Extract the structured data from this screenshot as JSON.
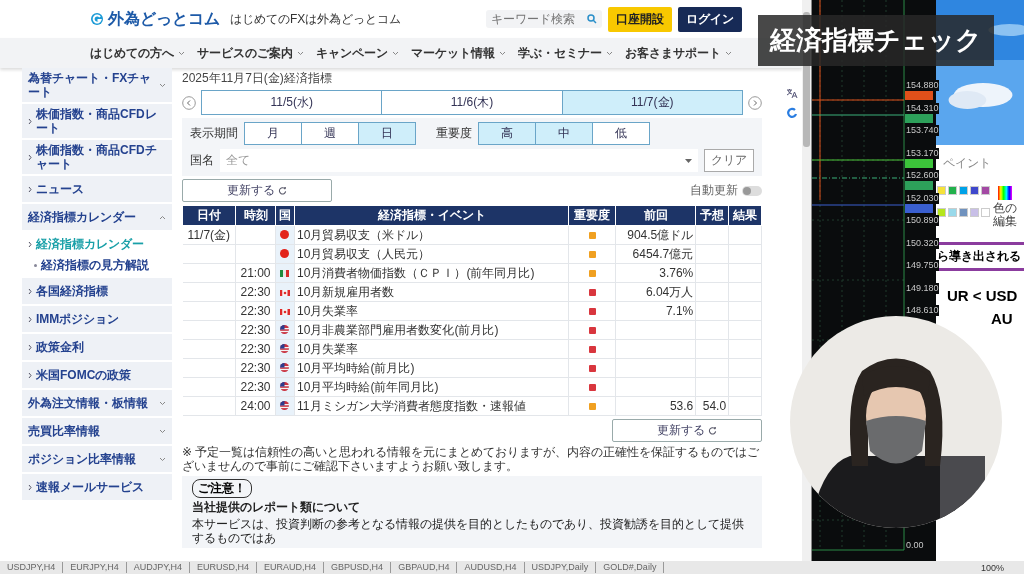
{
  "header": {
    "logo": "外為どっとコム",
    "tagline": "はじめてのFXは外為どっとコム",
    "search": {
      "placeholder": "キーワード検索"
    },
    "buttons": [
      {
        "kind": "open",
        "label": "口座開設"
      },
      {
        "kind": "login",
        "label": "ログイン"
      }
    ]
  },
  "nav": [
    "はじめての方へ",
    "サービスのご案内",
    "キャンペーン",
    "マーケット情報",
    "学ぶ・セミナー",
    "お客さまサポート"
  ],
  "sidebar": {
    "items": [
      {
        "kind": "group",
        "label": "為替チャート・FXチャート",
        "expanded": false
      },
      {
        "kind": "link",
        "label": "株価指数・商品CFDレート"
      },
      {
        "kind": "link",
        "label": "株価指数・商品CFDチャート"
      },
      {
        "kind": "link",
        "label": "ニュース"
      },
      {
        "kind": "group",
        "label": "経済指標カレンダー",
        "expanded": true,
        "children": [
          {
            "label": "経済指標カレンダー",
            "selected": true
          },
          {
            "label": "経済指標の見方解説",
            "selected": false
          }
        ]
      },
      {
        "kind": "link",
        "label": "各国経済指標"
      },
      {
        "kind": "link",
        "label": "IMMポジション"
      },
      {
        "kind": "link",
        "label": "政策金利"
      },
      {
        "kind": "link",
        "label": "米国FOMCの政策"
      },
      {
        "kind": "group",
        "label": "外為注文情報・板情報",
        "expanded": false
      },
      {
        "kind": "group",
        "label": "売買比率情報",
        "expanded": false
      },
      {
        "kind": "group",
        "label": "ポジション比率情報",
        "expanded": false
      },
      {
        "kind": "link",
        "label": "速報メールサービス"
      }
    ]
  },
  "main": {
    "heading": "2025年11月7日(金)経済指標",
    "date_tabs": [
      {
        "label": "11/5(水)",
        "selected": false
      },
      {
        "label": "11/6(木)",
        "selected": false
      },
      {
        "label": "11/7(金)",
        "selected": true
      }
    ],
    "filters": {
      "period": {
        "label": "表示期間",
        "options": [
          {
            "label": "月",
            "selected": false
          },
          {
            "label": "週",
            "selected": false
          },
          {
            "label": "日",
            "selected": true
          }
        ]
      },
      "importance": {
        "label": "重要度",
        "options": [
          {
            "label": "高",
            "selected": true
          },
          {
            "label": "中",
            "selected": true
          },
          {
            "label": "低",
            "selected": false
          }
        ]
      },
      "country": {
        "label": "国名",
        "value": "全て"
      },
      "clear_button": "クリア"
    },
    "refresh_button": "更新する",
    "auto_update": {
      "label": "自動更新",
      "on": false
    },
    "table": {
      "columns": [
        "日付",
        "時刻",
        "国",
        "経済指標・イベント",
        "重要度",
        "前回",
        "予想",
        "結果"
      ],
      "rows": [
        {
          "kind": "cn",
          "date": "11/7(金)",
          "event": "10月貿易収支（米ドル）",
          "color": "#f0a020",
          "previous": "904.5億ドル"
        },
        {
          "kind": "cn",
          "event": "10月貿易収支（人民元）",
          "color": "#f0a020",
          "previous": "6454.7億元"
        },
        {
          "kind": "mx",
          "time": "21:00",
          "event": "10月消費者物価指数（ＣＰＩ）(前年同月比)",
          "color": "#f0a020",
          "previous": "3.76%"
        },
        {
          "kind": "ca",
          "time": "22:30",
          "event": "10月新規雇用者数",
          "color": "#d9363e",
          "previous": "6.04万人"
        },
        {
          "kind": "ca",
          "time": "22:30",
          "event": "10月失業率",
          "color": "#d9363e",
          "previous": "7.1%"
        },
        {
          "kind": "us",
          "time": "22:30",
          "event": "10月非農業部門雇用者数変化(前月比)",
          "color": "#d9363e"
        },
        {
          "kind": "us",
          "time": "22:30",
          "event": "10月失業率",
          "color": "#d9363e"
        },
        {
          "kind": "us",
          "time": "22:30",
          "event": "10月平均時給(前月比)",
          "color": "#d9363e"
        },
        {
          "kind": "us",
          "time": "22:30",
          "event": "10月平均時給(前年同月比)",
          "color": "#d9363e"
        },
        {
          "kind": "us",
          "time": "24:00",
          "event": "11月ミシガン大学消費者態度指数・速報値",
          "color": "#f0a020",
          "previous": "53.6",
          "forecast": "54.0"
        }
      ]
    },
    "refresh_button_bottom": "更新する",
    "disclaimer": "※ 予定一覧は信頼性の高いと思われる情報を元にまとめておりますが、内容の正確性を保証するものではございませんので事前にご確認下さいますようお願い致します。",
    "notice": {
      "badge": "ご注意！",
      "title": "当社提供のレポート類について",
      "text": "本サービスは、投資判断の参考となる情報の提供を目的としたものであり、投資勧誘を目的として提供するものではあ"
    }
  },
  "chart": {
    "price_scale": [
      "154.880",
      "154.310",
      "153.740",
      "153.170",
      "152.600",
      "152.030",
      "150.890",
      "150.320",
      "149.750",
      "149.180",
      "148.610"
    ],
    "bottom_label": "0.00"
  },
  "paint": {
    "label": "ペイント",
    "palette": [
      {
        "color": "#f5e23a"
      },
      {
        "color": "#22b14c"
      },
      {
        "color": "#00a2e8"
      },
      {
        "color": "#3f48cc"
      },
      {
        "color": "#a349a4"
      },
      {
        "color": "#b5e61d"
      },
      {
        "color": "#99d9ea"
      },
      {
        "color": "#7092be"
      },
      {
        "color": "#c8bfe7"
      },
      {
        "color": "#ffffff"
      }
    ],
    "edit_colors": "色の編集",
    "banner": "ら導き出される",
    "lines": [
      "UR < USD",
      "AU"
    ]
  },
  "overlay_title": "経済指標チェック",
  "taskbar": {
    "tabs": [
      "USDJPY,H4",
      "EURJPY,H4",
      "AUDJPY,H4",
      "EURUSD,H4",
      "EURAUD,H4",
      "GBPUSD,H4",
      "GBPAUD,H4",
      "AUDUSD,H4",
      "USDJPY,Daily",
      "GOLD#,Daily"
    ],
    "zoom": "100%"
  }
}
